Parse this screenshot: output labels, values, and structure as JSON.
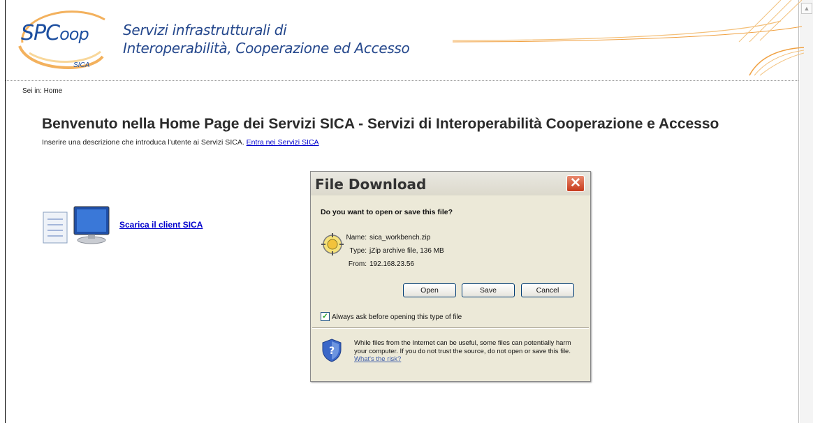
{
  "header": {
    "logo_main": "SPC",
    "logo_tail": "oop",
    "logo_sub": "SICA",
    "title_line1": "Servizi infrastrutturali di",
    "title_line2": "Interoperabilità, Cooperazione ed Accesso"
  },
  "breadcrumb": "Sei in: Home",
  "main": {
    "title": "Benvenuto nella Home Page dei Servizi SICA - Servizi di Interoperabilità Cooperazione e Accesso",
    "description": "Inserire una descrizione che introduca l'utente ai Servizi SICA.",
    "enter_link": "Entra nei Servizi SICA",
    "client_link": "Scarica il client SICA"
  },
  "dialog": {
    "title": "File Download",
    "close_glyph": "✕",
    "question": "Do you want to open or save this file?",
    "name_label": "Name:",
    "name_value": "sica_workbench.zip",
    "type_label": "Type:",
    "type_value": "jZip archive file, 136 MB",
    "from_label": "From:",
    "from_value": "192.168.23.56",
    "open_button": "Open",
    "save_button": "Save",
    "cancel_button": "Cancel",
    "checkbox_label": "Always ask before opening this type of file",
    "checkbox_checked": true,
    "warning_text": "While files from the Internet can be useful, some files can potentially harm your computer. If you do not trust the source, do not open or save this file.",
    "risk_link": "What's the risk?"
  },
  "colors": {
    "brand_blue": "#1d4fa0",
    "link_blue": "#0000cc",
    "swoosh_orange": "#f0a040"
  },
  "icons": [
    "client-computer-icon",
    "file-download-icon",
    "security-shield-icon",
    "close-icon",
    "checkmark-icon",
    "scroll-up-arrow-icon"
  ]
}
